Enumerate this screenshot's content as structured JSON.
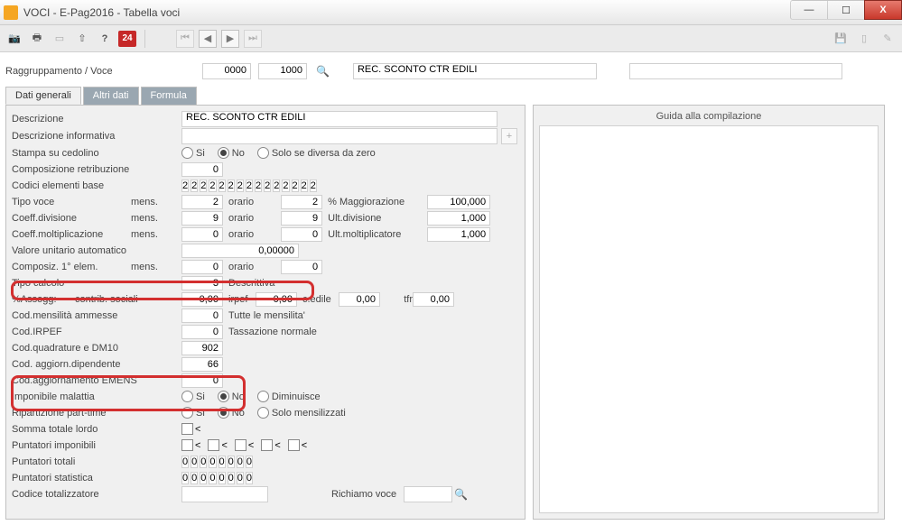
{
  "window": {
    "title": "VOCI  -  E-Pag2016  -  Tabella voci"
  },
  "toolbar": {
    "badge24": "24"
  },
  "header": {
    "label": "Raggruppamento / Voce",
    "code0": "0000",
    "code1": "1000",
    "desc": "REC. SCONTO CTR EDILI"
  },
  "tabs": {
    "t0": "Dati generali",
    "t1": "Altri dati",
    "t2": "Formula"
  },
  "f": {
    "descrizione_lbl": "Descrizione",
    "descrizione_val": "REC. SCONTO CTR EDILI",
    "descinfo_lbl": "Descrizione informativa",
    "stampa_lbl": "Stampa su cedolino",
    "opt_si": "Si",
    "opt_no": "No",
    "opt_solo": "Solo se diversa da zero",
    "compretr_lbl": "Composizione retribuzione",
    "compretr_val": "0",
    "codicibase_lbl": "Codici elementi base",
    "codicibase_vals": [
      "2",
      "2",
      "2",
      "2",
      "2",
      "2",
      "2",
      "2",
      "2",
      "2",
      "2",
      "2",
      "2",
      "2",
      "2"
    ],
    "mens": "mens.",
    "orario": "orario",
    "tipovoce_lbl": "Tipo voce",
    "tipovoce_mens": "2",
    "tipovoce_or": "2",
    "pctmagg_lbl": "% Maggiorazione",
    "pctmagg_val": "100,000",
    "coeffdiv_lbl": "Coeff.divisione",
    "coeffdiv_mens": "9",
    "coeffdiv_or": "9",
    "ultdiv_lbl": "Ult.divisione",
    "ultdiv_val": "1,000",
    "coeffmolt_lbl": "Coeff.moltiplicazione",
    "coeffmolt_mens": "0",
    "coeffmolt_or": "0",
    "ultmolt_lbl": "Ult.moltiplicatore",
    "ultmolt_val": "1,000",
    "valunit_lbl": "Valore unitario automatico",
    "valunit_val": "0,00000",
    "compos1_lbl": "Composiz. 1° elem.",
    "compos1_mens": "0",
    "compos1_or": "0",
    "tipocalc_lbl": "Tipo calcolo",
    "tipocalc_val": "3",
    "tipocalc_txt": "Descrittiva",
    "assogg_lbl": "%Assogg:",
    "assogg_sub": "contrib. sociali",
    "assogg_cs": "0,00",
    "irpef": "irpef",
    "assogg_ir": "0,00",
    "cedile": "c.edile",
    "assogg_ce": "0,00",
    "tfr": "tfr",
    "assogg_tfr": "0,00",
    "codmens_lbl": "Cod.mensilità ammesse",
    "codmens_val": "0",
    "codmens_txt": "Tutte le mensilita'",
    "codirpef_lbl": "Cod.IRPEF",
    "codirpef_val": "0",
    "codirpef_txt": "Tassazione normale",
    "codquad_lbl": "Cod.quadrature e DM10",
    "codquad_val": "902",
    "codaggdip_lbl": "Cod. aggiorn.dipendente",
    "codaggdip_val": "66",
    "codaggemens_lbl": "Cod.aggiornamento EMENS",
    "codaggemens_val": "0",
    "impmal_lbl": "Imponibile malattia",
    "opt_dim": "Diminuisce",
    "rippt_lbl": "Ripartizione part-time",
    "opt_solomens": "Solo mensilizzati",
    "somma_lbl": "Somma totale lordo",
    "lt": "<",
    "puntimp_lbl": "Puntatori imponibili",
    "punttot_lbl": "Puntatori totali",
    "punttot_vals": [
      "0",
      "0",
      "0",
      "0",
      "0",
      "0",
      "0",
      "0"
    ],
    "puntstat_lbl": "Puntatori statistica",
    "puntstat_vals": [
      "0",
      "0",
      "0",
      "0",
      "0",
      "0",
      "0",
      "0"
    ],
    "codtot_lbl": "Codice totalizzatore",
    "richiamo_lbl": "Richiamo voce"
  },
  "side": {
    "title": "Guida alla compilazione"
  }
}
